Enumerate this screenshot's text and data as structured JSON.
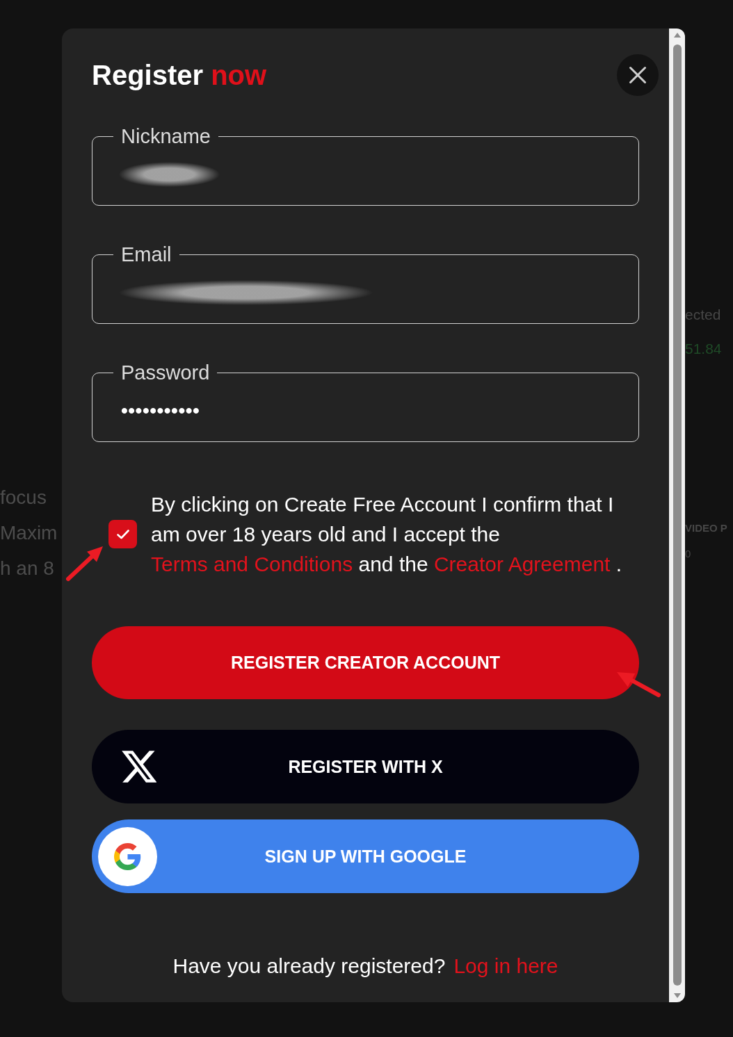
{
  "background": {
    "left_texts": [
      "focus",
      "Maxim",
      "h an 8"
    ],
    "right_items": [
      {
        "kind": "label",
        "text": "ected"
      },
      {
        "kind": "change",
        "text": "51.84"
      },
      {
        "kind": "heading",
        "text": "VIDEO P"
      },
      {
        "kind": "value",
        "text": "0"
      }
    ]
  },
  "dialog": {
    "title": {
      "text": "Register",
      "accent": "now"
    },
    "fields": [
      {
        "label": "Nickname",
        "blurred": true
      },
      {
        "label": "Email",
        "blurred": true
      },
      {
        "label": "Password",
        "value": "•••••••••••",
        "blurred": false
      }
    ],
    "consent": {
      "checked": true,
      "parts": [
        {
          "kind": "text",
          "text": "By clicking on Create Free Account I confirm that I am over 18 years old and I accept the"
        },
        {
          "kind": "link",
          "text": "Terms and Conditions"
        },
        {
          "kind": "text",
          "text": "and the"
        },
        {
          "kind": "link",
          "text": "Creator Agreement"
        },
        {
          "kind": "text",
          "text": "."
        }
      ]
    },
    "buttons": [
      {
        "kind": "primary",
        "label": "REGISTER CREATOR ACCOUNT"
      },
      {
        "kind": "x",
        "label": "REGISTER WITH X"
      },
      {
        "kind": "google",
        "label": "SIGN UP WITH GOOGLE"
      }
    ],
    "footer": {
      "text": "Have you already registered?",
      "link": "Log in here"
    }
  }
}
